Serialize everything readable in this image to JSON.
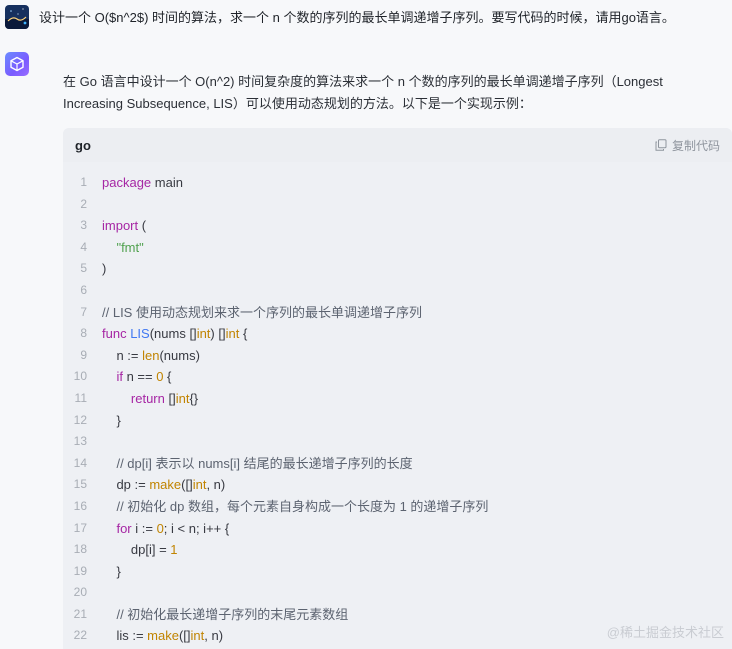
{
  "user": {
    "message": "设计一个 O($n^2$) 时间的算法，求一个 n 个数的序列的最长单调递增子序列。要写代码的时候，请用go语言。"
  },
  "assistant": {
    "intro_line1": "在 Go 语言中设计一个 O(n^2) 时间复杂度的算法来求一个 n 个数的序列的最长单调递增子序列（Longest",
    "intro_line2": "Increasing Subsequence, LIS）可以使用动态规划的方法。以下是一个实现示例："
  },
  "code_block": {
    "language": "go",
    "copy_label": "复制代码",
    "lines": [
      {
        "n": "1",
        "text": "package main"
      },
      {
        "n": "2",
        "text": ""
      },
      {
        "n": "3",
        "text": "import ("
      },
      {
        "n": "4",
        "text": "    \"fmt\""
      },
      {
        "n": "5",
        "text": ")"
      },
      {
        "n": "6",
        "text": ""
      },
      {
        "n": "7",
        "text": "// LIS 使用动态规划来求一个序列的最长单调递增子序列"
      },
      {
        "n": "8",
        "text": "func LIS(nums []int) []int {"
      },
      {
        "n": "9",
        "text": "    n := len(nums)"
      },
      {
        "n": "10",
        "text": "    if n == 0 {"
      },
      {
        "n": "11",
        "text": "        return []int{}"
      },
      {
        "n": "12",
        "text": "    }"
      },
      {
        "n": "13",
        "text": ""
      },
      {
        "n": "14",
        "text": "    // dp[i] 表示以 nums[i] 结尾的最长递增子序列的长度"
      },
      {
        "n": "15",
        "text": "    dp := make([]int, n)"
      },
      {
        "n": "16",
        "text": "    // 初始化 dp 数组，每个元素自身构成一个长度为 1 的递增子序列"
      },
      {
        "n": "17",
        "text": "    for i := 0; i < n; i++ {"
      },
      {
        "n": "18",
        "text": "        dp[i] = 1"
      },
      {
        "n": "19",
        "text": "    }"
      },
      {
        "n": "20",
        "text": ""
      },
      {
        "n": "21",
        "text": "    // 初始化最长递增子序列的末尾元素数组"
      },
      {
        "n": "22",
        "text": "    lis := make([]int, n)"
      }
    ]
  },
  "watermark": "@稀土掘金技术社区",
  "colors": {
    "background": "#f7f8fa",
    "code_bg": "#eef0f4",
    "keyword": "#a626a4",
    "function": "#4078f2",
    "string": "#50a14f",
    "number": "#c18401",
    "comment": "#5c6370"
  }
}
